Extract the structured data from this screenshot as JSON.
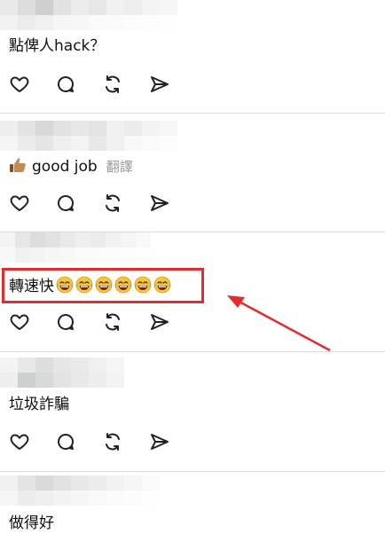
{
  "posts": [
    {
      "text": "點俾人hack？",
      "translate": ""
    },
    {
      "text": "good job",
      "translate": "翻譯"
    },
    {
      "text": "轉速快",
      "translate": ""
    },
    {
      "text": "垃圾詐騙",
      "translate": ""
    },
    {
      "text": "做得好",
      "translate": ""
    }
  ],
  "icons": {
    "like": "heart-icon",
    "comment": "comment-bubble-icon",
    "repost": "repost-icon",
    "share": "send-icon"
  },
  "annotation": {
    "highlight_color": "#e02d2d",
    "arrow_color": "#e02d2d"
  },
  "emoji_count": 6
}
